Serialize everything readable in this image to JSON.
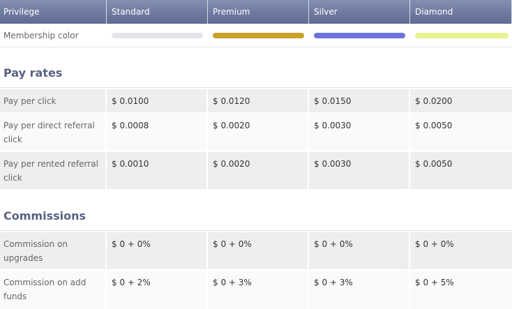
{
  "header": {
    "privilege": "Privilege",
    "standard": "Standard",
    "premium": "Premium",
    "silver": "Silver",
    "diamond": "Diamond"
  },
  "membership": {
    "label": "Membership color",
    "colors": {
      "standard": "#e6e3ea",
      "premium": "#c9a22a",
      "silver": "#6b74da",
      "diamond": "#e6f28f"
    }
  },
  "pay_rates": {
    "title": "Pay rates",
    "rows": [
      {
        "label": "Pay per click",
        "standard": "$ 0.0100",
        "premium": "$ 0.0120",
        "silver": "$ 0.0150",
        "diamond": "$ 0.0200"
      },
      {
        "label_line1": "Pay per direct referral",
        "label_line2": "click",
        "standard": "$ 0.0008",
        "premium": "$ 0.0020",
        "silver": "$ 0.0030",
        "diamond": "$ 0.0050"
      },
      {
        "label_line1": "Pay per rented referral",
        "label_line2": "click",
        "standard": "$ 0.0010",
        "premium": "$ 0.0020",
        "silver": "$ 0.0030",
        "diamond": "$ 0.0050"
      }
    ]
  },
  "commissions": {
    "title": "Commissions",
    "rows": [
      {
        "label_line1": "Commission on",
        "label_line2": "upgrades",
        "standard": "$ 0 + 0%",
        "premium": "$ 0 + 0%",
        "silver": "$ 0 + 0%",
        "diamond": "$ 0 + 0%"
      },
      {
        "label_line1": "Commission on add",
        "label_line2": "funds",
        "standard": "$ 0 + 2%",
        "premium": "$ 0 + 3%",
        "silver": "$ 0 + 3%",
        "diamond": "$ 0 + 5%"
      }
    ]
  }
}
